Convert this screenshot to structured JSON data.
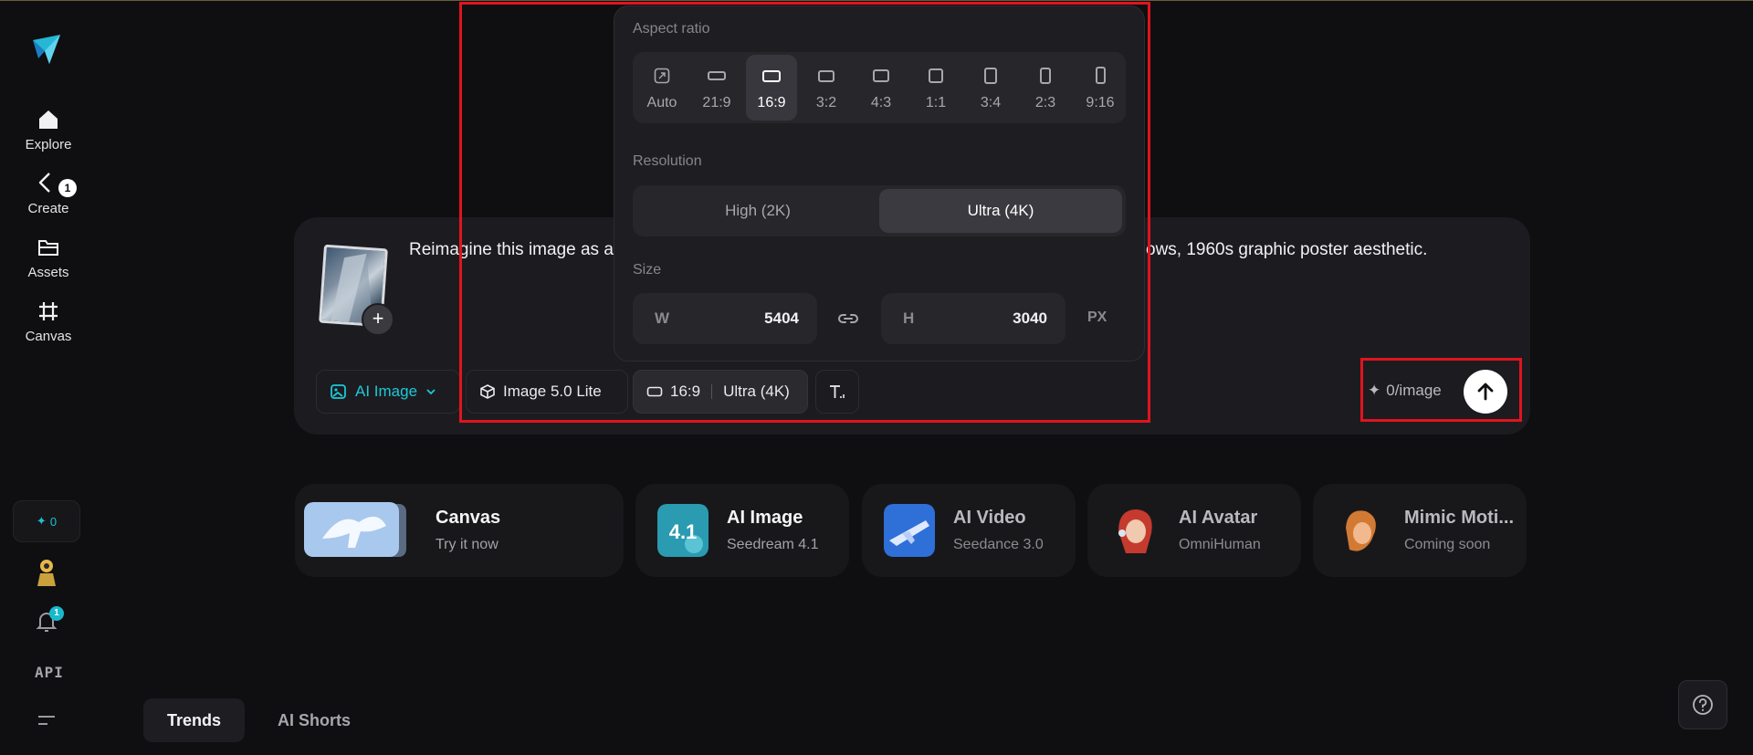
{
  "sidebar": {
    "nav": [
      {
        "label": "Explore",
        "icon": "home-icon"
      },
      {
        "label": "Create",
        "icon": "create-icon",
        "badge": "1"
      },
      {
        "label": "Assets",
        "icon": "folder-icon"
      },
      {
        "label": "Canvas",
        "icon": "canvas-icon"
      }
    ],
    "credits": "0",
    "notification_count": "1",
    "api_label": "API"
  },
  "prompt": {
    "text_left": "Reimagine this image as a",
    "text_right": "ows, 1960s graphic poster aesthetic.",
    "add_label": "+"
  },
  "toolbar": {
    "mode": "AI Image",
    "model": "Image 5.0 Lite",
    "ratio": "16:9",
    "resolution": "Ultra (4K)",
    "cost": "0/image"
  },
  "popover": {
    "aspect_title": "Aspect ratio",
    "ratios": [
      "Auto",
      "21:9",
      "16:9",
      "3:2",
      "4:3",
      "1:1",
      "3:4",
      "2:3",
      "9:16"
    ],
    "selected_ratio": "16:9",
    "resolution_title": "Resolution",
    "resolutions": [
      "High (2K)",
      "Ultra (4K)"
    ],
    "selected_resolution": "Ultra (4K)",
    "size_title": "Size",
    "width_label": "W",
    "width_value": "5404",
    "height_label": "H",
    "height_value": "3040",
    "unit": "PX"
  },
  "features": [
    {
      "title": "Canvas",
      "subtitle": "Try it now"
    },
    {
      "title": "AI Image",
      "subtitle": "Seedream 4.1"
    },
    {
      "title": "AI Video",
      "subtitle": "Seedance 3.0"
    },
    {
      "title": "AI Avatar",
      "subtitle": "OmniHuman"
    },
    {
      "title": "Mimic Moti...",
      "subtitle": "Coming soon"
    }
  ],
  "tabs": [
    "Trends",
    "AI Shorts"
  ],
  "colors": {
    "accent": "#1ec7d8",
    "highlight": "#e0141e",
    "background": "#0f0f11"
  }
}
